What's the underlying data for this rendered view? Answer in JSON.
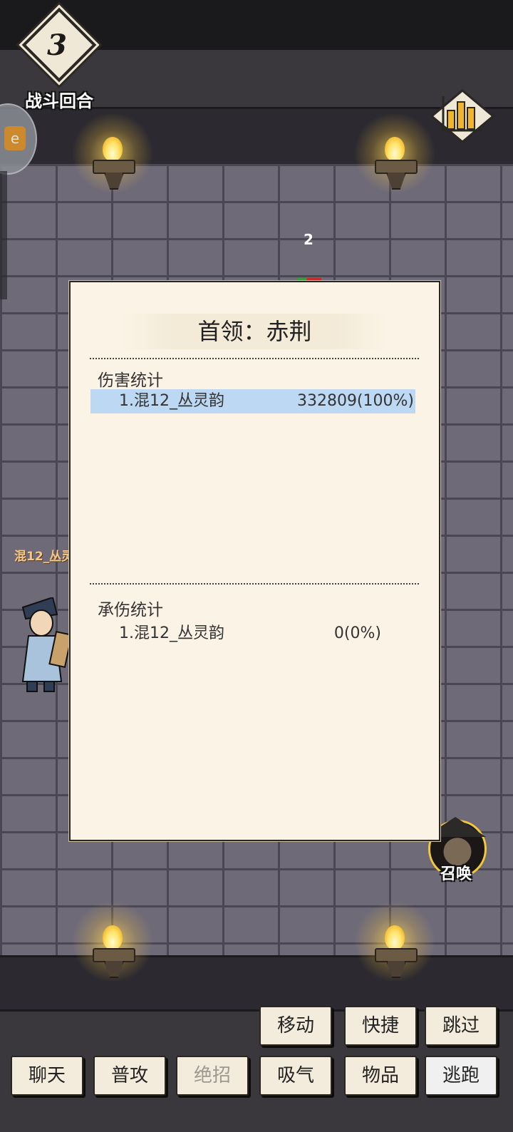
{
  "round": {
    "number": "3",
    "label": "战斗回合"
  },
  "side_tab_icon": "game-center-icon",
  "stats_icon": "bar-chart-icon",
  "enemy": {
    "count": "2"
  },
  "dialog": {
    "title": "首领：赤荆",
    "damage_section": {
      "title": "伤害统计",
      "rows": [
        {
          "name": "1.混12_丛灵韵",
          "value": "332809(100%)"
        }
      ]
    },
    "taken_section": {
      "title": "承伤统计",
      "rows": [
        {
          "name": "1.混12_丛灵韵",
          "value": "0(0%)"
        }
      ]
    }
  },
  "player": {
    "name": "混12_丛灵"
  },
  "summon": {
    "label": "召唤"
  },
  "actions_top": {
    "move": "移动",
    "quick": "快捷",
    "skip": "跳过"
  },
  "actions_bottom": {
    "chat": "聊天",
    "attack": "普攻",
    "ultimate": "绝招",
    "breathe": "吸气",
    "items": "物品",
    "flee": "逃跑"
  },
  "colors": {
    "highlight_row": "#bcd8f2",
    "dialog_bg": "#fbf4e6",
    "wall": "#6e6a78"
  }
}
